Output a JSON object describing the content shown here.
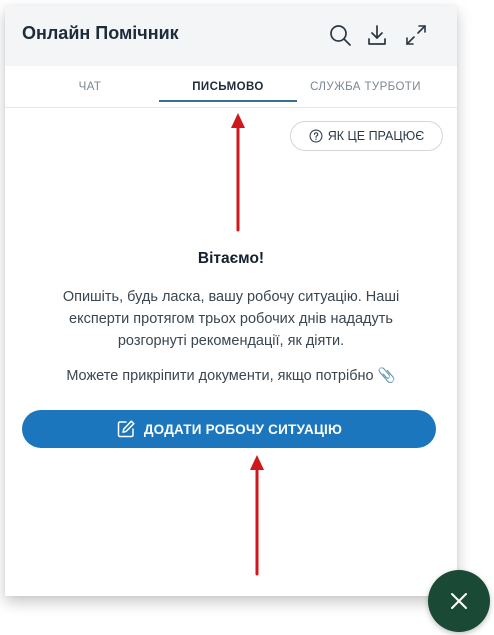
{
  "header": {
    "title": "Онлайн Помічник",
    "icons": [
      "search-icon",
      "download-icon",
      "expand-icon"
    ]
  },
  "tabs": [
    {
      "label": "ЧАТ",
      "active": false
    },
    {
      "label": "ПИСЬМОВО",
      "active": true
    },
    {
      "label": "СЛУЖБА ТУРБОТИ",
      "active": false
    }
  ],
  "how_it_works": {
    "label": "ЯК ЦЕ ПРАЦЮЄ",
    "icon": "question-circle-icon"
  },
  "main": {
    "welcome": "Вітаємо!",
    "description": "Опишіть, будь ласка, вашу робочу ситуацію. Наші експерти протягом трьох робочих днів нададуть розгорнуті рекомендації, як діяти.",
    "attach_hint": "Можете прикріпити документи, якщо потрібно 📎",
    "add_button": "ДОДАТИ РОБОЧУ СИТУАЦІЮ"
  },
  "fab": {
    "icon": "close-icon"
  },
  "colors": {
    "accent": "#1c76bd",
    "fab": "#1a4a35",
    "tab_underline": "#3b6f8f",
    "annotation_arrow": "#d0171b"
  }
}
